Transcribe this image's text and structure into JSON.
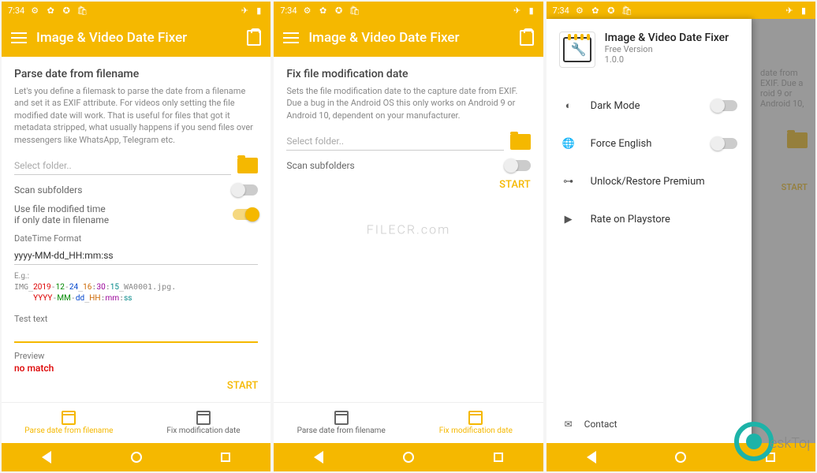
{
  "status": {
    "time": "7:34"
  },
  "app": {
    "title": "Image & Video Date Fixer"
  },
  "screen1": {
    "title": "Parse date from filename",
    "desc": "Let's you define a filemask to parse the date from a filename and set it as EXIF attribute. For videos only setting the file modified date will work. That is useful for files that got it metadata stripped, what usually happens if you send files over messengers like WhatsApp, Telegram etc.",
    "select_folder": "Select folder..",
    "scan_subfolders": "Scan subfolders",
    "use_modified": "Use file modified time\nif only date in filename",
    "dt_format_label": "DateTime Format",
    "dt_format_value": "yyyy-MM-dd_HH:mm:ss",
    "example_label": "E.g.:",
    "example_line1": "IMG_2019-12-24_16:30:15_WA0001.jpg.",
    "test_label": "Test text",
    "preview_label": "Preview",
    "no_match": "no match",
    "start": "START"
  },
  "screen2": {
    "title": "Fix file modification date",
    "desc": "Sets the file modification date to the capture date from EXIF. Due a bug in the Android OS this only works on Android 9 or Android 10, dependent on your manufacturer.",
    "select_folder": "Select folder..",
    "scan_subfolders": "Scan subfolders",
    "start": "START",
    "watermark": "FILECR.com"
  },
  "nav": {
    "tab1": "Parse date from filename",
    "tab2": "Fix modification date"
  },
  "drawer": {
    "title": "Image & Video Date Fixer",
    "sub1": "Free Version",
    "sub2": "1.0.0",
    "dark_mode": "Dark Mode",
    "force_english": "Force English",
    "unlock": "Unlock/Restore Premium",
    "rate": "Rate on Playstore",
    "contact": "Contact"
  },
  "bg3": {
    "desc_frag": "date from EXIF. Due a\nroid 9 or Android 10,",
    "start": "START"
  }
}
